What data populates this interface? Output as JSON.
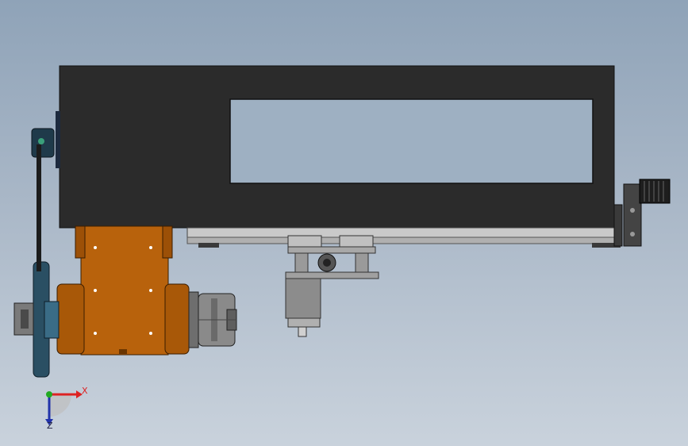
{
  "viewport": {
    "background_top": "#8fa3b8",
    "background_bottom": "#c9d2dc"
  },
  "model": {
    "parts": {
      "frame": "frame-housing",
      "spindle_block": "spindle-block",
      "chuck": "chuck",
      "pulley": "pulley",
      "belt": "drive-belt",
      "guide_rail": "guide-rail",
      "carriage": "linear-carriage",
      "tool_post": "tool-post",
      "stepper_motor": "stepper-motor"
    },
    "colors": {
      "frame": "#2b2b2b",
      "spindle_block": "#b8620c",
      "metal": "#8e8e8e",
      "rail": "#c9c9c9",
      "belt": "#1f3a4a"
    }
  },
  "triad": {
    "x_label": "X",
    "z_label": "Z",
    "x_color": "#dd2222",
    "z_color": "#2233aa",
    "origin_color": "#22aa22"
  }
}
